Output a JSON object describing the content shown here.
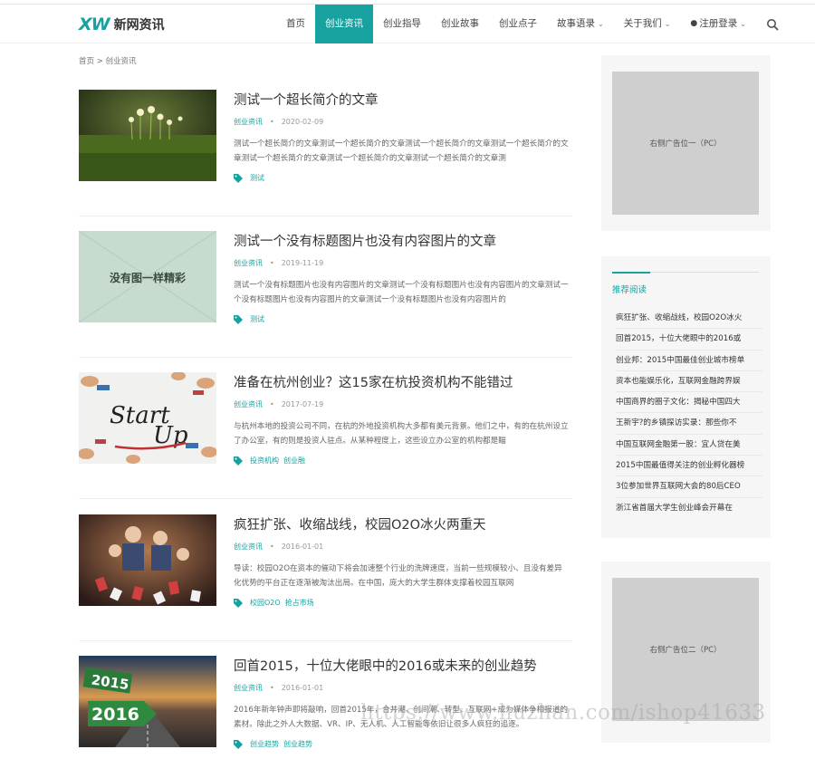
{
  "header": {
    "logo_mark": "XW",
    "logo_text": "新网资讯",
    "nav": [
      {
        "label": "首页",
        "active": false
      },
      {
        "label": "创业资讯",
        "active": true
      },
      {
        "label": "创业指导",
        "active": false
      },
      {
        "label": "创业故事",
        "active": false
      },
      {
        "label": "创业点子",
        "active": false
      },
      {
        "label": "故事语录",
        "active": false
      },
      {
        "label": "关于我们",
        "active": false
      },
      {
        "label": "注册登录",
        "active": false
      }
    ]
  },
  "breadcrumb": "首页 > 创业资讯",
  "articles": [
    {
      "title": "测试一个超长简介的文章",
      "category": "创业资讯",
      "date": "2020-02-09",
      "excerpt": "测试一个超长简介的文章测试一个超长简介的文章测试一个超长简介的文章测试一个超长简介的文章测试一个超长简介的文章测试一个超长简介的文章测试一个超长简介的文章测",
      "tags": [
        "测试"
      ]
    },
    {
      "title": "测试一个没有标题图片也没有内容图片的文章",
      "category": "创业资讯",
      "date": "2019-11-19",
      "excerpt": "测试一个没有标题图片也没有内容图片的文章测试一个没有标题图片也没有内容图片的文章测试一个没有标题图片也没有内容图片的文章测试一个没有标题图片也没有内容图片的",
      "tags": [
        "测试"
      ],
      "thumb_text": "没有图一样精彩"
    },
    {
      "title": "准备在杭州创业？这15家在杭投资机构不能错过",
      "category": "创业资讯",
      "date": "2017-07-19",
      "excerpt": "与杭州本地的投资公司不同，在杭的外地投资机构大多都有美元背景。他们之中，有的在杭州设立了办公室，有的则是投资人驻点。从某种程度上，这些设立办公室的机构都是瞄",
      "tags": [
        "投资机构",
        "创业融"
      ],
      "thumb_text_1": "Start",
      "thumb_text_2": "Up"
    },
    {
      "title": "疯狂扩张、收缩战线，校园O2O冰火两重天",
      "category": "创业资讯",
      "date": "2016-01-01",
      "excerpt": "导读：校园O2O在资本的催动下将会加速整个行业的洗牌速度，当前一些规模较小、且没有差异化优势的平台正在逐渐被淘汰出局。在中国，庞大的大学生群体支撑着校园互联网",
      "tags": [
        "校园O2O",
        "抢占市场"
      ]
    },
    {
      "title": "回首2015，十位大佬眼中的2016或未来的创业趋势",
      "category": "创业资讯",
      "date": "2016-01-01",
      "excerpt": "2016年新年钟声即将敲响，回首2015年，合并潮、创间潮、转型、互联网+成为媒体争相报道的素材。除此之外人大数据、VR、IP、无人机、人工智能等依旧让很多人疯狂的追逐。",
      "tags": [
        "创业趋势",
        "创业趋势"
      ],
      "thumb_text_1": "2015",
      "thumb_text_2": "2016"
    }
  ],
  "sidebar": {
    "ad1": "右侧广告位一（PC）",
    "ad2": "右侧广告位二（PC）",
    "recommend_title": "推荐阅读",
    "recommend": [
      "疯狂扩张、收缩战线，校园O2O冰火",
      "回首2015，十位大佬眼中的2016或",
      "创业邦：2015中国最佳创业城市榜单",
      "资本也能娱乐化，互联网金融跨界娱",
      "中国商界的圈子文化：揭秘中国四大",
      "王新宇?的乡镇探访实录：那些你不",
      "中国互联网金融第一股：宜人贷在美",
      "2015中国最值得关注的创业孵化器榜",
      "3位参加世界互联网大会的80后CEO",
      "浙江省首届大学生创业峰会开幕在"
    ]
  },
  "watermark": "https://www.huzhan.com/ishop41633",
  "colors": {
    "accent": "#17a2a0",
    "ad_gray": "#cfcfcf",
    "sidebar_bg": "#f6f6f6"
  },
  "icons": [
    "search-icon",
    "user-icon",
    "chevron-down-icon",
    "tag-icon"
  ]
}
